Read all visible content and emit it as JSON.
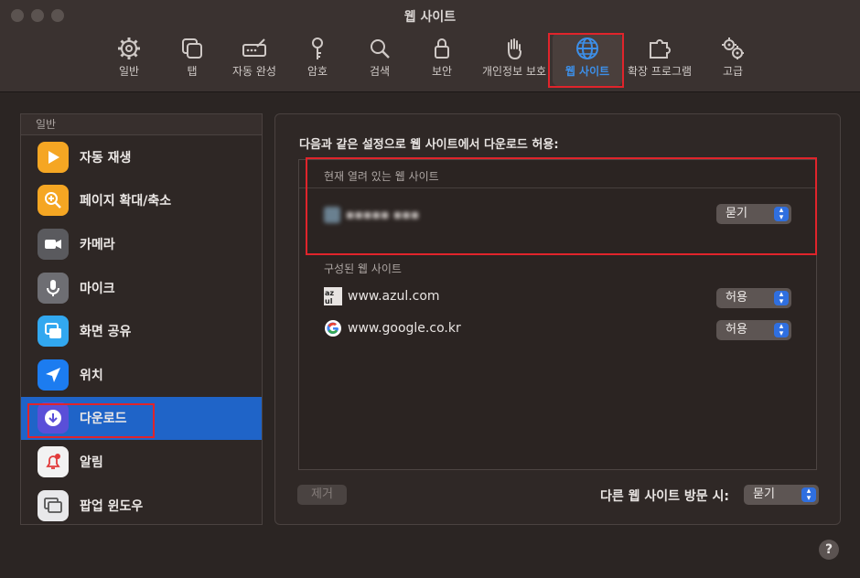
{
  "window": {
    "title": "웹 사이트"
  },
  "toolbar": {
    "items": [
      {
        "label": "일반",
        "icon": "gear-icon"
      },
      {
        "label": "탭",
        "icon": "tabs-icon"
      },
      {
        "label": "자동 완성",
        "icon": "autofill-icon"
      },
      {
        "label": "암호",
        "icon": "key-icon"
      },
      {
        "label": "검색",
        "icon": "search-icon"
      },
      {
        "label": "보안",
        "icon": "lock-icon"
      },
      {
        "label": "개인정보 보호",
        "icon": "hand-icon"
      },
      {
        "label": "웹 사이트",
        "icon": "globe-icon",
        "active": true
      },
      {
        "label": "확장 프로그램",
        "icon": "puzzle-icon"
      },
      {
        "label": "고급",
        "icon": "gears-icon"
      }
    ]
  },
  "sidebar": {
    "header": "일반",
    "items": [
      {
        "label": "자동 재생",
        "icon": "play-icon",
        "color": "#f5a623"
      },
      {
        "label": "페이지 확대/축소",
        "icon": "zoom-icon",
        "color": "#f5a623"
      },
      {
        "label": "카메라",
        "icon": "camera-icon",
        "color": "#5a5a5e"
      },
      {
        "label": "마이크",
        "icon": "microphone-icon",
        "color": "#6e6e73"
      },
      {
        "label": "화면 공유",
        "icon": "screen-share-icon",
        "color": "#32a8f0"
      },
      {
        "label": "위치",
        "icon": "location-icon",
        "color": "#1c7cf0"
      },
      {
        "label": "다운로드",
        "icon": "download-icon",
        "color": "#5a4fd8",
        "selected": true
      },
      {
        "label": "알림",
        "icon": "bell-icon",
        "color": "#f2f2f2"
      },
      {
        "label": "팝업 윈도우",
        "icon": "popup-window-icon",
        "color": "#e8e8ea"
      }
    ]
  },
  "panel": {
    "title": "다음과 같은 설정으로 웹 사이트에서 다운로드 허용:",
    "current_section": "현재 열려 있는 웹 사이트",
    "current_site": {
      "name": "▪▪▪▪▪ ▪▪▪",
      "value": "묻기"
    },
    "configured_section": "구성된 웹 사이트",
    "configured_sites": [
      {
        "name": "www.azul.com",
        "value": "허용",
        "icon": "azul-favicon-icon"
      },
      {
        "name": "www.google.co.kr",
        "value": "허용",
        "icon": "google-favicon-icon"
      }
    ],
    "remove_label": "제거",
    "other_label": "다른 웹 사이트 방문 시:",
    "other_value": "묻기"
  },
  "colors": {
    "accent": "#1f64c8",
    "active_tab": "#3d8fe8",
    "highlight": "#e0242b"
  },
  "help_label": "?"
}
